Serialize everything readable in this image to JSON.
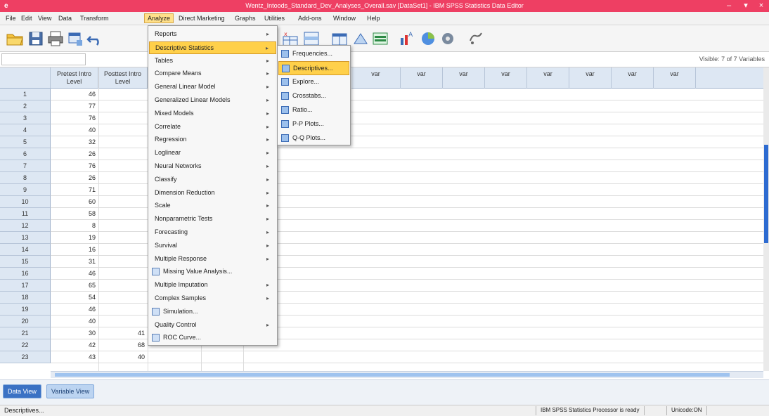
{
  "window": {
    "title": "Wentz_Intoods_Standard_Dev_Analyses_Overall.sav [DataSet1] - IBM SPSS Statistics Data Editor",
    "icon_glyph": "e"
  },
  "menubar": [
    {
      "label": "File"
    },
    {
      "label": "Edit"
    },
    {
      "label": "View"
    },
    {
      "label": "Data"
    },
    {
      "label": "Transform"
    },
    {
      "label": "Analyze"
    },
    {
      "label": "Direct Marketing"
    },
    {
      "label": "Graphs"
    },
    {
      "label": "Utilities"
    },
    {
      "label": "Add-ons"
    },
    {
      "label": "Window"
    },
    {
      "label": "Help"
    }
  ],
  "cellbar": {
    "visible_label": "Visible: 7 of 7 Variables"
  },
  "columns": [
    {
      "label": "Pretest Intro Level",
      "line2": ""
    },
    {
      "label": "Posttest Intro Level",
      "line2": ""
    },
    {
      "label": "var"
    },
    {
      "label": "var"
    },
    {
      "label": "var"
    },
    {
      "label": "var"
    },
    {
      "label": "var"
    },
    {
      "label": "var"
    },
    {
      "label": "var"
    },
    {
      "label": "var"
    },
    {
      "label": "var"
    },
    {
      "label": "var"
    }
  ],
  "rows": [
    {
      "n": "1",
      "v1": "46",
      "v2": ""
    },
    {
      "n": "2",
      "v1": "77",
      "v2": ""
    },
    {
      "n": "3",
      "v1": "76",
      "v2": ""
    },
    {
      "n": "4",
      "v1": "40",
      "v2": ""
    },
    {
      "n": "5",
      "v1": "32",
      "v2": ""
    },
    {
      "n": "6",
      "v1": "26",
      "v2": ""
    },
    {
      "n": "7",
      "v1": "76",
      "v2": ""
    },
    {
      "n": "8",
      "v1": "26",
      "v2": ""
    },
    {
      "n": "9",
      "v1": "71",
      "v2": ""
    },
    {
      "n": "10",
      "v1": "60",
      "v2": ""
    },
    {
      "n": "11",
      "v1": "58",
      "v2": ""
    },
    {
      "n": "12",
      "v1": "8",
      "v2": ""
    },
    {
      "n": "13",
      "v1": "19",
      "v2": ""
    },
    {
      "n": "14",
      "v1": "16",
      "v2": ""
    },
    {
      "n": "15",
      "v1": "31",
      "v2": ""
    },
    {
      "n": "16",
      "v1": "46",
      "v2": ""
    },
    {
      "n": "17",
      "v1": "65",
      "v2": ""
    },
    {
      "n": "18",
      "v1": "54",
      "v2": ""
    },
    {
      "n": "19",
      "v1": "46",
      "v2": ""
    },
    {
      "n": "20",
      "v1": "40",
      "v2": ""
    },
    {
      "n": "21",
      "v1": "30",
      "v2": "41"
    },
    {
      "n": "22",
      "v1": "42",
      "v2": "68"
    },
    {
      "n": "23",
      "v1": "43",
      "v2": "40"
    }
  ],
  "analyze_menu": [
    {
      "label": "Reports",
      "arrow": "▸"
    },
    {
      "label": "Descriptive Statistics",
      "arrow": "▸",
      "highlight": true
    },
    {
      "label": "Tables",
      "arrow": "▸"
    },
    {
      "label": "Compare Means",
      "arrow": "▸"
    },
    {
      "label": "General Linear Model",
      "arrow": "▸"
    },
    {
      "label": "Generalized Linear Models",
      "arrow": "▸"
    },
    {
      "label": "Mixed Models",
      "arrow": "▸"
    },
    {
      "label": "Correlate",
      "arrow": "▸"
    },
    {
      "label": "Regression",
      "arrow": "▸"
    },
    {
      "label": "Loglinear",
      "arrow": "▸"
    },
    {
      "label": "Neural Networks",
      "arrow": "▸"
    },
    {
      "label": "Classify",
      "arrow": "▸"
    },
    {
      "label": "Dimension Reduction",
      "arrow": "▸"
    },
    {
      "label": "Scale",
      "arrow": "▸"
    },
    {
      "label": "Nonparametric Tests",
      "arrow": "▸"
    },
    {
      "label": "Forecasting",
      "arrow": "▸"
    },
    {
      "label": "Survival",
      "arrow": "▸"
    },
    {
      "label": "Multiple Response",
      "arrow": "▸"
    },
    {
      "label": "Missing Value Analysis...",
      "arrow": "",
      "icon": true
    },
    {
      "label": "Multiple Imputation",
      "arrow": "▸"
    },
    {
      "label": "Complex Samples",
      "arrow": "▸"
    },
    {
      "label": "Simulation...",
      "arrow": "",
      "icon": true
    },
    {
      "label": "Quality Control",
      "arrow": "▸"
    },
    {
      "label": "ROC Curve...",
      "arrow": "",
      "icon": true
    }
  ],
  "descriptive_submenu": [
    {
      "label": "Frequencies...",
      "highlight": false
    },
    {
      "label": "Descriptives...",
      "highlight": true
    },
    {
      "label": "Explore...",
      "highlight": false
    },
    {
      "label": "Crosstabs...",
      "highlight": false
    },
    {
      "label": "Ratio...",
      "highlight": false
    },
    {
      "label": "P-P Plots...",
      "highlight": false
    },
    {
      "label": "Q-Q Plots...",
      "highlight": false
    }
  ],
  "tabs": {
    "data_view": "Data View",
    "variable_view": "Variable View"
  },
  "status": {
    "left": "Descriptives...",
    "processor": "IBM SPSS Statistics Processor is ready",
    "unicode": "Unicode:ON"
  }
}
